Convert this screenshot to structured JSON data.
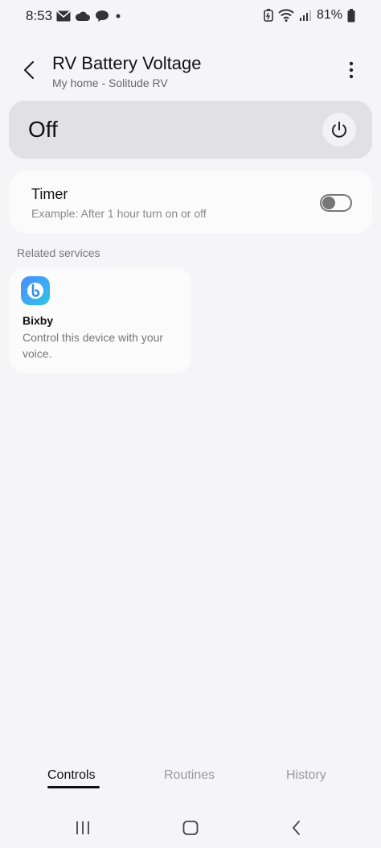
{
  "status_bar": {
    "time": "8:53",
    "battery": "81%",
    "left_icons": [
      "mail-icon",
      "cloud-icon",
      "chat-icon",
      "dot-icon"
    ],
    "right_icons": [
      "battery-saver-icon",
      "wifi-icon",
      "signal-icon",
      "battery-icon"
    ]
  },
  "header": {
    "title": "RV Battery Voltage",
    "subtitle": "My home - Solitude RV"
  },
  "power": {
    "state": "Off"
  },
  "timer": {
    "title": "Timer",
    "description": "Example: After 1 hour turn on or off",
    "enabled": false
  },
  "related": {
    "label": "Related services",
    "services": [
      {
        "name": "Bixby",
        "description": "Control this device with your voice.",
        "icon": "bixby-icon"
      }
    ]
  },
  "tabs": [
    {
      "label": "Controls",
      "active": true
    },
    {
      "label": "Routines",
      "active": false
    },
    {
      "label": "History",
      "active": false
    }
  ],
  "navbar": {
    "icons": [
      "recents-icon",
      "home-icon",
      "back-icon"
    ]
  },
  "colors": {
    "background": "#f5f5f7",
    "power_card": "#e1e1e3",
    "card": "#fbfbfc",
    "bixby_gradient_start": "#4e8cff",
    "bixby_gradient_end": "#2fc4e6"
  }
}
